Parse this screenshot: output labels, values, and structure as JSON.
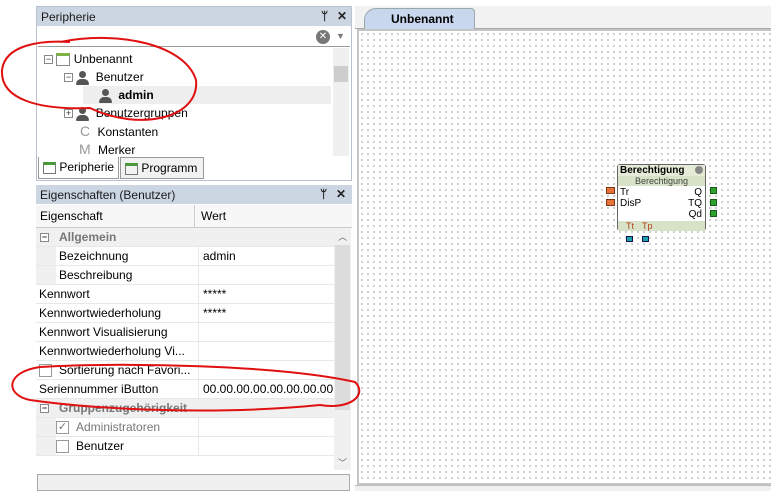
{
  "peripherie_panel": {
    "title": "Peripherie",
    "tree": [
      {
        "label": "Unbenannt",
        "icon": "project-icon"
      },
      {
        "label": "Benutzer",
        "icon": "user-icon"
      },
      {
        "label": "admin",
        "icon": "user-icon",
        "selected": true
      },
      {
        "label": "Benutzergruppen",
        "icon": "user-group-icon"
      },
      {
        "label": "Konstanten",
        "icon": "constant-icon",
        "glyph": "C"
      },
      {
        "label": "Merker",
        "icon": "marker-icon",
        "glyph": "M"
      }
    ],
    "tabs": [
      {
        "label": "Peripherie"
      },
      {
        "label": "Programm"
      }
    ]
  },
  "properties_panel": {
    "title": "Eigenschaften (Benutzer)",
    "columns": {
      "property": "Eigenschaft",
      "value": "Wert"
    },
    "groups": {
      "general": "Allgemein",
      "membership": "Gruppenzugehörigkeit"
    },
    "rows": [
      {
        "key": "Bezeichnung",
        "value": "admin"
      },
      {
        "key": "Beschreibung",
        "value": ""
      },
      {
        "key": "Kennwort",
        "value": "*****"
      },
      {
        "key": "Kennwortwiederholung",
        "value": "*****"
      },
      {
        "key": "Kennwort Visualisierung",
        "value": ""
      },
      {
        "key": "Kennwortwiederholung Vi...",
        "value": ""
      },
      {
        "key": "Sortierung nach Favori...",
        "value": ""
      },
      {
        "key": "Seriennummer iButton",
        "value": "00.00.00.00.00.00.00.00"
      }
    ],
    "members": [
      {
        "label": "Administratoren",
        "checked": true
      },
      {
        "label": "Benutzer",
        "checked": false
      }
    ]
  },
  "editor": {
    "tab_label": "Unbenannt",
    "block": {
      "title": "Berechtigung",
      "subtitle": "Berechtigung",
      "inputs": [
        "Tr",
        "DisP"
      ],
      "outputs": [
        "Q",
        "TQ",
        "Qd"
      ],
      "bottom": [
        "Tt",
        "Tp"
      ]
    }
  },
  "colors": {
    "annotation": "#e01010",
    "header": "#ccd6e2",
    "tab_active": "#c5d3ec",
    "block_header": "#dfe8d0"
  }
}
